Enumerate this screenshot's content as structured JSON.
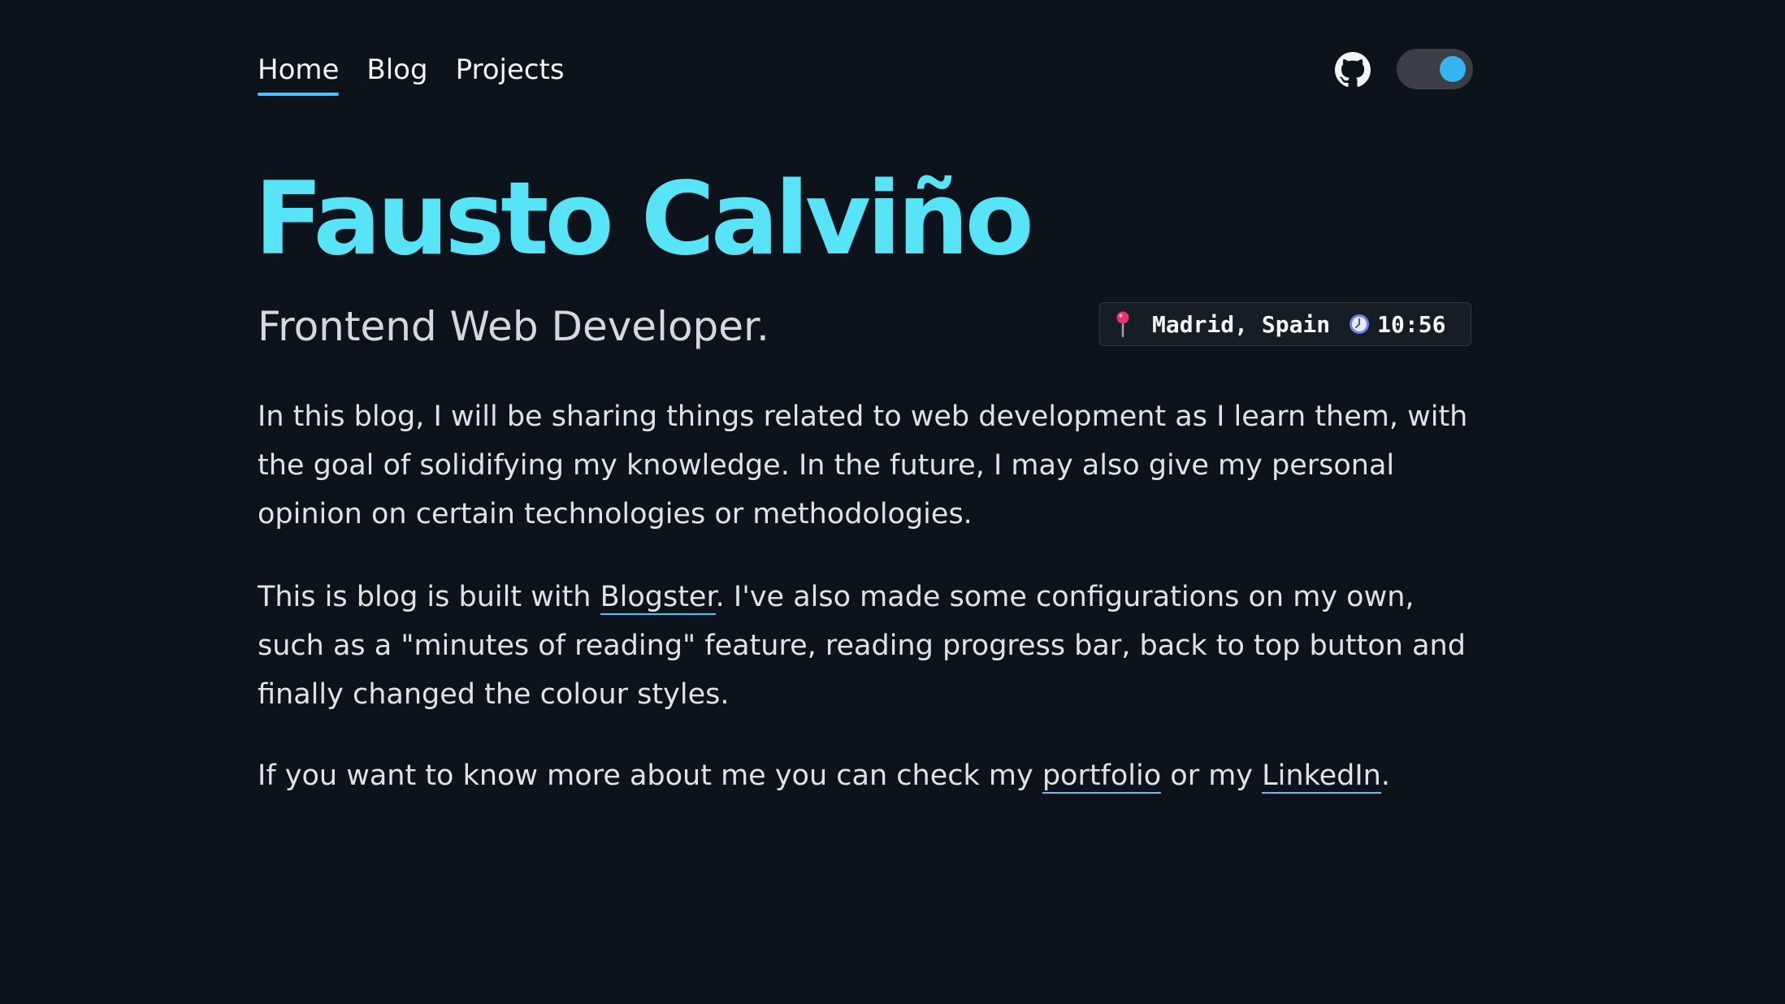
{
  "nav": {
    "links": [
      {
        "label": "Home",
        "active": true
      },
      {
        "label": "Blog",
        "active": false
      },
      {
        "label": "Projects",
        "active": false
      }
    ],
    "github_icon": "github-icon",
    "theme_toggle": {
      "state": "on",
      "knob_color": "#35b5f0"
    }
  },
  "hero": {
    "name": "Fausto Calviño",
    "subtitle": "Frontend Web Developer."
  },
  "badge": {
    "location_icon": "map-pin-icon",
    "location": "Madrid, Spain",
    "clock_icon": "clock-icon",
    "time": "10:56"
  },
  "intro": {
    "p1": "In this blog, I will be sharing things related to web development as I learn them, with the goal of solidifying my knowledge. In the future, I may also give my personal opinion on certain technologies or methodologies.",
    "p2_before": "This is blog is built with ",
    "p2_link": "Blogster",
    "p2_after": ". I've also made some configurations on my own, such as a \"minutes of reading\" feature, reading progress bar, back to top button and finally changed the colour styles.",
    "p3_before": "If you want to know more about me you can check my ",
    "p3_link1": "portfolio",
    "p3_middle": " or my ",
    "p3_link2": "LinkedIn",
    "p3_after": "."
  },
  "colors": {
    "background": "#0d131b",
    "accent": "#58e4f7",
    "link_underline": "#4fc3f7"
  }
}
